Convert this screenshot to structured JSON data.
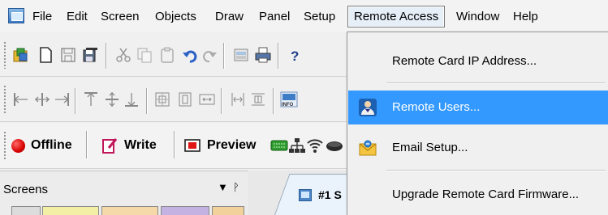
{
  "menubar": {
    "items": [
      {
        "label": "File"
      },
      {
        "label": "Edit"
      },
      {
        "label": "Screen"
      },
      {
        "label": "Objects"
      },
      {
        "label": "Draw"
      },
      {
        "label": "Panel"
      },
      {
        "label": "Setup"
      },
      {
        "label": "Remote Access"
      },
      {
        "label": "Window"
      },
      {
        "label": "Help"
      }
    ]
  },
  "toolbar1": {
    "icons": [
      "open-project-icon",
      "new-file-icon",
      "save-icon",
      "save-all-icon",
      "cut-icon",
      "copy-icon",
      "paste-icon",
      "undo-icon",
      "redo-icon",
      "screen-view-icon",
      "print-icon",
      "help-icon"
    ]
  },
  "toolbar2": {
    "icons": [
      "align-left-icon",
      "align-center-vertical-icon",
      "align-right-icon",
      "align-top-icon",
      "align-middle-icon",
      "align-bottom-icon",
      "center-both-icon",
      "center-vertical-icon",
      "center-horizontal-icon",
      "same-width-icon",
      "same-height-icon",
      "info-screen-icon"
    ],
    "info_icon_text": "INFO"
  },
  "toolbar3": {
    "offline_label": "Offline",
    "write_label": "Write",
    "preview_label": "Preview",
    "device_icons": [
      "keyboard-icon",
      "network-icon",
      "wifi-icon",
      "device-icon"
    ],
    "offline_color": "#d80000"
  },
  "screens_pane": {
    "title": "Screens",
    "dropdown_glyph": "▼",
    "pin_glyph": "ᚹ"
  },
  "document_tab": {
    "label": "#1 S"
  },
  "remote_access_menu": {
    "items": [
      {
        "label": "Remote Card IP Address...",
        "icon": null,
        "highlighted": false
      },
      {
        "label": "Remote Users...",
        "icon": "users-icon",
        "highlighted": true
      },
      {
        "label": "Email Setup...",
        "icon": "email-icon",
        "highlighted": false
      },
      {
        "label": "Upgrade Remote Card Firmware...",
        "icon": null,
        "highlighted": false
      }
    ],
    "highlight_color": "#3399ff"
  }
}
